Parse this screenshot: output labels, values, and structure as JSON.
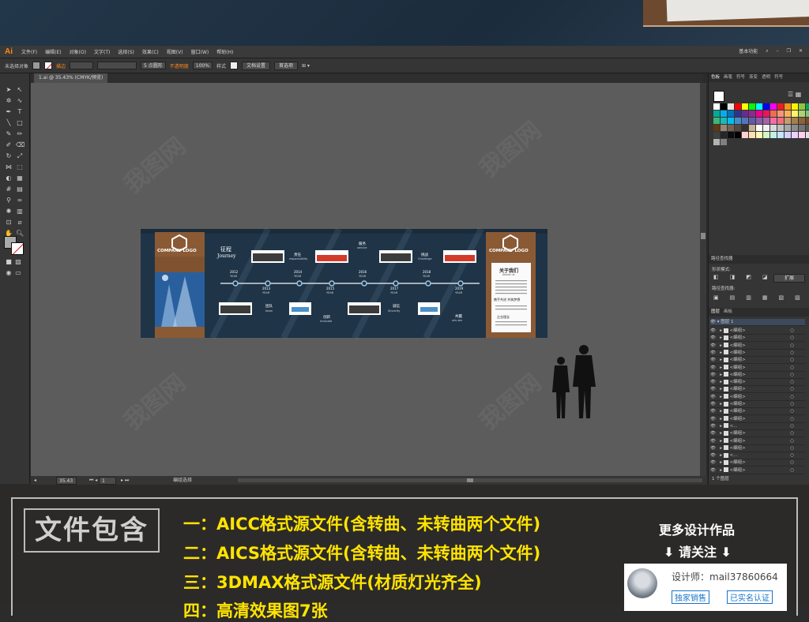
{
  "menu": {
    "app_logo": "Ai",
    "items": [
      "文件(F)",
      "编辑(E)",
      "对象(O)",
      "文字(T)",
      "选择(S)",
      "效果(C)",
      "视图(V)",
      "窗口(W)",
      "帮助(H)"
    ],
    "workspace": "基本功能"
  },
  "control": {
    "selection": "未选择对象",
    "stroke_label": "描边",
    "point_size": "5 点圆形",
    "opacity_label": "不透明度",
    "opacity_value": "100%",
    "style_label": "样式",
    "doc_setup": "文档设置",
    "preferences": "首选项"
  },
  "document": {
    "tab": "1.ai @ 35.43% (CMYK/预览)",
    "zoom": "35.43",
    "page": "1",
    "status": "编组选择"
  },
  "artwork": {
    "company_logo_left": "COMPANY LOGO",
    "company_logo_right": "COMPANY LOGO",
    "journey_cn": "征程",
    "journey_en": "Journey",
    "items_top": [
      {
        "cn": "责任",
        "en": "responsibility"
      },
      {
        "cn": "服务",
        "en": "service"
      },
      {
        "cn": "挑战",
        "en": "Challenge"
      }
    ],
    "items_bottom": [
      {
        "cn": "团队",
        "en": "team"
      },
      {
        "cn": "创新",
        "en": "innovate"
      },
      {
        "cn": "诚信",
        "en": "Sincerity"
      },
      {
        "cn": "共赢",
        "en": "win-win"
      }
    ],
    "years": [
      "2012",
      "2013",
      "2014",
      "2015",
      "2016",
      "2017",
      "2018",
      "2019"
    ],
    "year_label": "YEAR",
    "about_cn": "关于我们",
    "about_en": "About us",
    "slogan": "携手共进 共筑梦想",
    "culture": "企业理念"
  },
  "panels": {
    "swatch_tabs": [
      "色板",
      "画笔",
      "符号",
      "渐变",
      "透明",
      "符号"
    ],
    "pathfinder_title": "路径查找器",
    "shape_mode": "形状模式:",
    "pathfinder": "路径查找器:",
    "expand": "扩展",
    "layers_tabs": [
      "图层",
      "画板"
    ],
    "layer_top": "图层 1",
    "layer_items": [
      "<编组>",
      "<编组>",
      "<编组>",
      "<编组>",
      "<编组>",
      "<编组>",
      "<编组>",
      "<编组>",
      "<编组>",
      "<编组>",
      "<编组>",
      "<编组>",
      "<编组>",
      "<...",
      "<编组>",
      "<编组>",
      "<编组>",
      "<...",
      "<编组>",
      "<编组>"
    ],
    "layer_count": "1 个图层"
  },
  "bottom": {
    "includes": "文件包含",
    "line1": "一：AICC格式源文件(含转曲、未转曲两个文件)",
    "line2": "二：AICS格式源文件(含转曲、未转曲两个文件)",
    "line3": "三：3DMAX格式源文件(材质灯光齐全)",
    "line4": "四：高清效果图7张",
    "more": "更多设计作品",
    "follow": "⬇ 请关注 ⬇",
    "designer": "设计师：mail37860664",
    "tag1": "独家销售",
    "tag2": "已实名认证"
  },
  "colors": {
    "accent": "#ff8a1c",
    "wall": "#1f3447",
    "wood": "#8a5a35",
    "bottom_text": "#ffe400"
  }
}
